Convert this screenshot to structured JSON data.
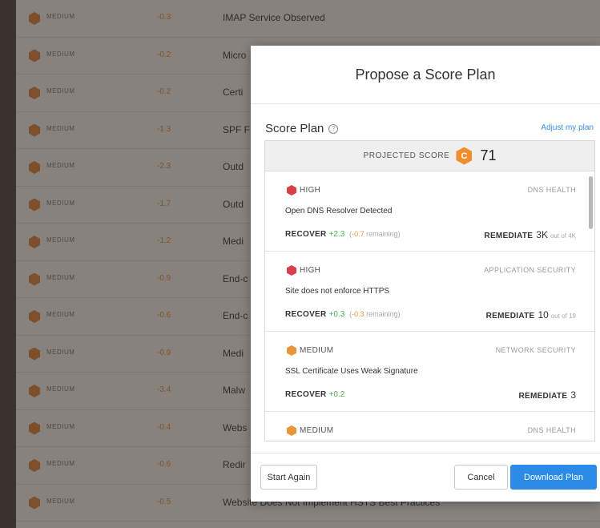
{
  "background": {
    "rows": [
      {
        "severity": "MEDIUM",
        "delta": "-0.3",
        "title": "IMAP Service Observed"
      },
      {
        "severity": "MEDIUM",
        "delta": "-0.2",
        "title": "Micro"
      },
      {
        "severity": "MEDIUM",
        "delta": "-0.2",
        "title": "Certi"
      },
      {
        "severity": "MEDIUM",
        "delta": "-1.3",
        "title": "SPF F"
      },
      {
        "severity": "MEDIUM",
        "delta": "-2.3",
        "title": "Outd"
      },
      {
        "severity": "MEDIUM",
        "delta": "-1.7",
        "title": "Outd"
      },
      {
        "severity": "MEDIUM",
        "delta": "-1.2",
        "title": "Medi"
      },
      {
        "severity": "MEDIUM",
        "delta": "-0.9",
        "title": "End-c"
      },
      {
        "severity": "MEDIUM",
        "delta": "-0.6",
        "title": "End-c"
      },
      {
        "severity": "MEDIUM",
        "delta": "-0.9",
        "title": "Medi"
      },
      {
        "severity": "MEDIUM",
        "delta": "-3.4",
        "title": "Malw"
      },
      {
        "severity": "MEDIUM",
        "delta": "-0.4",
        "title": "Webs"
      },
      {
        "severity": "MEDIUM",
        "delta": "-0.6",
        "title": "Redir"
      },
      {
        "severity": "MEDIUM",
        "delta": "-0.5",
        "title": "Website Does Not Implement HSTS Best Practices"
      }
    ]
  },
  "modal": {
    "title": "Propose a Score Plan",
    "plan_title": "Score Plan",
    "help_glyph": "?",
    "adjust_link": "Adjust my plan",
    "projected_label": "PROJECTED SCORE",
    "grade": "C",
    "projected_value": "71",
    "recover_label": "RECOVER",
    "remediate_label": "REMEDIATE",
    "issues": [
      {
        "severity": "HIGH",
        "category": "DNS HEALTH",
        "name": "Open DNS Resolver Detected",
        "gain": "+2.3",
        "remaining_value": "-0.7",
        "remaining_suffix": " remaining)",
        "remediate_count": "3K",
        "out_of": "out of 4K"
      },
      {
        "severity": "HIGH",
        "category": "APPLICATION SECURITY",
        "name": "Site does not enforce HTTPS",
        "gain": "+0.3",
        "remaining_value": "-0.3",
        "remaining_suffix": " remaining)",
        "remediate_count": "10",
        "out_of": "out of 19"
      },
      {
        "severity": "MEDIUM",
        "category": "NETWORK SECURITY",
        "name": "SSL Certificate Uses Weak Signature",
        "gain": "+0.2",
        "remediate_count": "3"
      },
      {
        "severity": "MEDIUM",
        "category": "DNS HEALTH"
      }
    ],
    "buttons": {
      "start_again": "Start Again",
      "cancel": "Cancel",
      "download": "Download Plan"
    }
  }
}
